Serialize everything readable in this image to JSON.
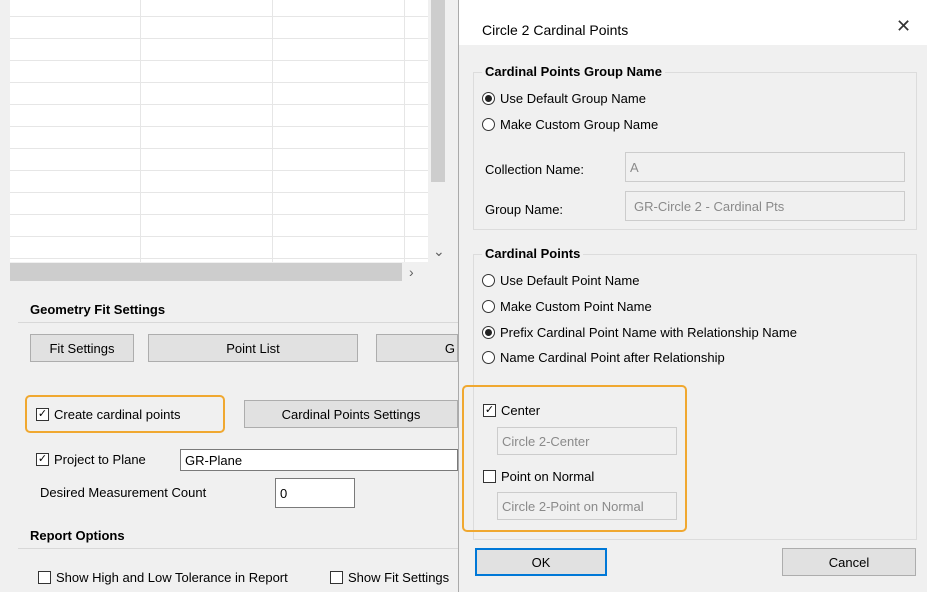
{
  "background": {
    "geometry_fit": {
      "title": "Geometry Fit Settings",
      "fit_settings_label": "Fit Settings",
      "point_list_label": "Point List",
      "truncated_button_label": "G",
      "create_cardinal_label": "Create cardinal points",
      "create_cardinal_checked": true,
      "cardinal_settings_label": "Cardinal Points Settings",
      "project_to_plane_label": "Project to Plane",
      "project_to_plane_checked": true,
      "plane_value": "GR-Plane",
      "desired_count_label": "Desired Measurement Count",
      "desired_count_value": "0"
    },
    "report_options": {
      "title": "Report Options",
      "show_tolerance_label": "Show High and Low Tolerance in Report",
      "show_fit_label": "Show Fit Settings"
    }
  },
  "dialog": {
    "title": "Circle 2 Cardinal Points",
    "close_symbol": "✕",
    "group_name": {
      "title": "Cardinal Points Group Name",
      "options": [
        "Use Default Group Name",
        "Make Custom Group Name"
      ],
      "selected_index": 0,
      "collection_label": "Collection Name:",
      "collection_value": "A",
      "group_label": "Group Name:",
      "group_value": "GR-Circle 2 - Cardinal Pts"
    },
    "cardinal_points": {
      "title": "Cardinal Points",
      "options": [
        "Use Default Point Name",
        "Make Custom Point Name",
        "Prefix Cardinal Point Name with Relationship Name",
        "Name Cardinal Point after Relationship"
      ],
      "selected_index": 2
    },
    "points": {
      "center_label": "Center",
      "center_checked": true,
      "center_value": "Circle 2-Center",
      "normal_label": "Point on Normal",
      "normal_checked": false,
      "normal_value": "Circle 2-Point on Normal"
    },
    "ok_label": "OK",
    "cancel_label": "Cancel"
  },
  "colors": {
    "highlight": "#f0a830",
    "panel": "#f0f0f0",
    "ok_border": "#0078d7"
  }
}
